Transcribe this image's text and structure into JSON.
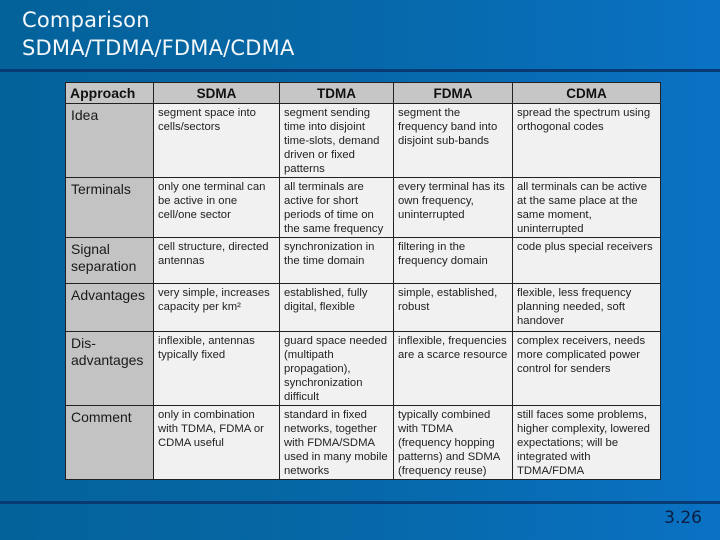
{
  "slide": {
    "title_line1": "Comparison",
    "title_line2": "SDMA/TDMA/FDMA/CDMA",
    "page_number": "3.26"
  },
  "table": {
    "headers": [
      "Approach",
      "SDMA",
      "TDMA",
      "FDMA",
      "CDMA"
    ],
    "rows": [
      {
        "label": "Idea",
        "cells": [
          "segment space into cells/sectors",
          "segment sending time into disjoint time-slots, demand driven or fixed patterns",
          "segment the frequency band into disjoint sub-bands",
          "spread the spectrum using orthogonal codes"
        ]
      },
      {
        "label": "Terminals",
        "cells": [
          "only one terminal can be active in one cell/one sector",
          "all terminals are active for short periods of time on the same frequency",
          "every terminal has its own frequency, uninterrupted",
          "all terminals can be active at the same place at the same moment, uninterrupted"
        ]
      },
      {
        "label": "Signal separation",
        "cells": [
          "cell structure, directed antennas",
          "synchronization in the time domain",
          "filtering in the frequency domain",
          "code plus special receivers"
        ]
      },
      {
        "label": "Advantages",
        "cells": [
          "very simple, increases capacity per km²",
          "established, fully digital, flexible",
          "simple, established, robust",
          "flexible, less frequency planning needed, soft handover"
        ]
      },
      {
        "label": "Dis-\nadvantages",
        "cells": [
          "inflexible, antennas typically fixed",
          "guard space needed (multipath propagation), synchronization difficult",
          "inflexible, frequencies are a scarce resource",
          "complex receivers, needs more complicated power control for senders"
        ]
      },
      {
        "label": "Comment",
        "cells": [
          "only in combination with TDMA, FDMA or CDMA useful",
          "standard in fixed networks, together with FDMA/SDMA used in many mobile networks",
          "typically combined with TDMA (frequency hopping patterns) and SDMA (frequency reuse)",
          "still faces some problems, higher complexity, lowered expectations; will be integrated with TDMA/FDMA"
        ]
      }
    ]
  }
}
